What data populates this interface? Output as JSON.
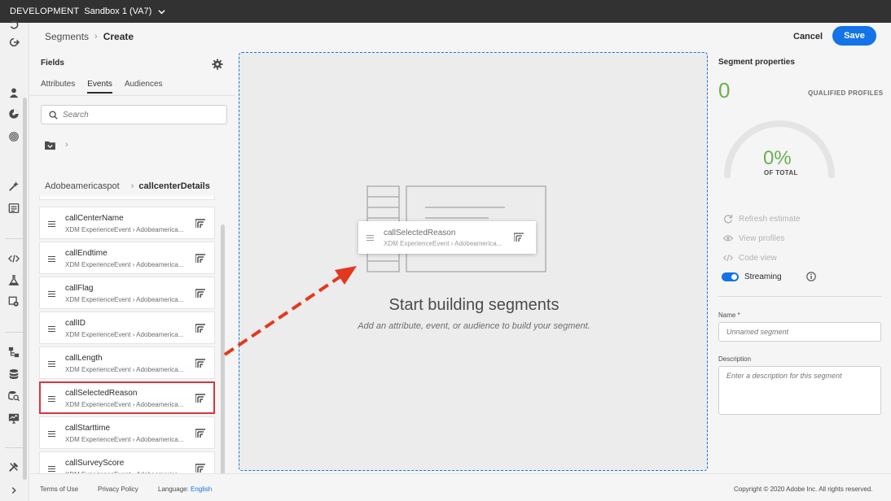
{
  "topbar": {
    "environment": "DEVELOPMENT",
    "sandbox": "Sandbox 1 (VA7)"
  },
  "breadcrumb": {
    "parent": "Segments",
    "current": "Create"
  },
  "actions": {
    "cancel": "Cancel",
    "save": "Save"
  },
  "fields": {
    "title": "Fields",
    "tabs": [
      {
        "label": "Attributes",
        "active": false
      },
      {
        "label": "Events",
        "active": true
      },
      {
        "label": "Audiences",
        "active": false
      }
    ],
    "search_placeholder": "Search",
    "path": {
      "parent": "Adobeamericaspot",
      "current": "callcenterDetails"
    },
    "items": [
      {
        "name": "callCenterName",
        "path": "XDM ExperienceEvent › Adobeamerica...",
        "highlighted": false
      },
      {
        "name": "callEndtime",
        "path": "XDM ExperienceEvent › Adobeamerica...",
        "highlighted": false
      },
      {
        "name": "callFlag",
        "path": "XDM ExperienceEvent › Adobeamerica...",
        "highlighted": false
      },
      {
        "name": "callID",
        "path": "XDM ExperienceEvent › Adobeamerica...",
        "highlighted": false
      },
      {
        "name": "callLength",
        "path": "XDM ExperienceEvent › Adobeamerica...",
        "highlighted": false
      },
      {
        "name": "callSelectedReason",
        "path": "XDM ExperienceEvent › Adobeamerica...",
        "highlighted": true
      },
      {
        "name": "callStarttime",
        "path": "XDM ExperienceEvent › Adobeamerica...",
        "highlighted": false
      },
      {
        "name": "callSurveyScore",
        "path": "XDM ExperienceEvent › Adobeamerica...",
        "highlighted": false
      }
    ]
  },
  "canvas": {
    "drag_item": {
      "name": "callSelectedReason",
      "path": "XDM ExperienceEvent › Adobeamerica..."
    },
    "title": "Start building segments",
    "subtitle": "Add an attribute, event, or audience to build your segment."
  },
  "properties": {
    "title": "Segment properties",
    "qualified_count": "0",
    "qualified_label": "QUALIFIED PROFILES",
    "percent": "0%",
    "percent_label": "OF TOTAL",
    "refresh": "Refresh estimate",
    "view_profiles": "View profiles",
    "code_view": "Code view",
    "streaming": "Streaming",
    "streaming_enabled": true,
    "name_label": "Name *",
    "name_placeholder": "Unnamed segment",
    "description_label": "Description",
    "description_placeholder": "Enter a description for this segment"
  },
  "footer": {
    "terms": "Terms of Use",
    "privacy": "Privacy Policy",
    "language_label": "Language:",
    "language_value": "English",
    "copyright": "Copyright © 2020 Adobe Inc. All rights reserved."
  },
  "colors": {
    "accent": "#1473e6",
    "highlight": "#d7373f",
    "success": "#6bb04f",
    "arrow": "#e4381e"
  },
  "icons": {
    "rail": [
      "undo-icon",
      "share-icon",
      "user-icon",
      "segments-icon",
      "fingerprint-icon",
      "wand-icon",
      "form-icon",
      "code-icon",
      "flask-icon",
      "settings-icon",
      "hierarchy-icon",
      "database-icon",
      "dataset-search-icon",
      "monitor-icon",
      "tools-icon",
      "expand-icon"
    ]
  }
}
